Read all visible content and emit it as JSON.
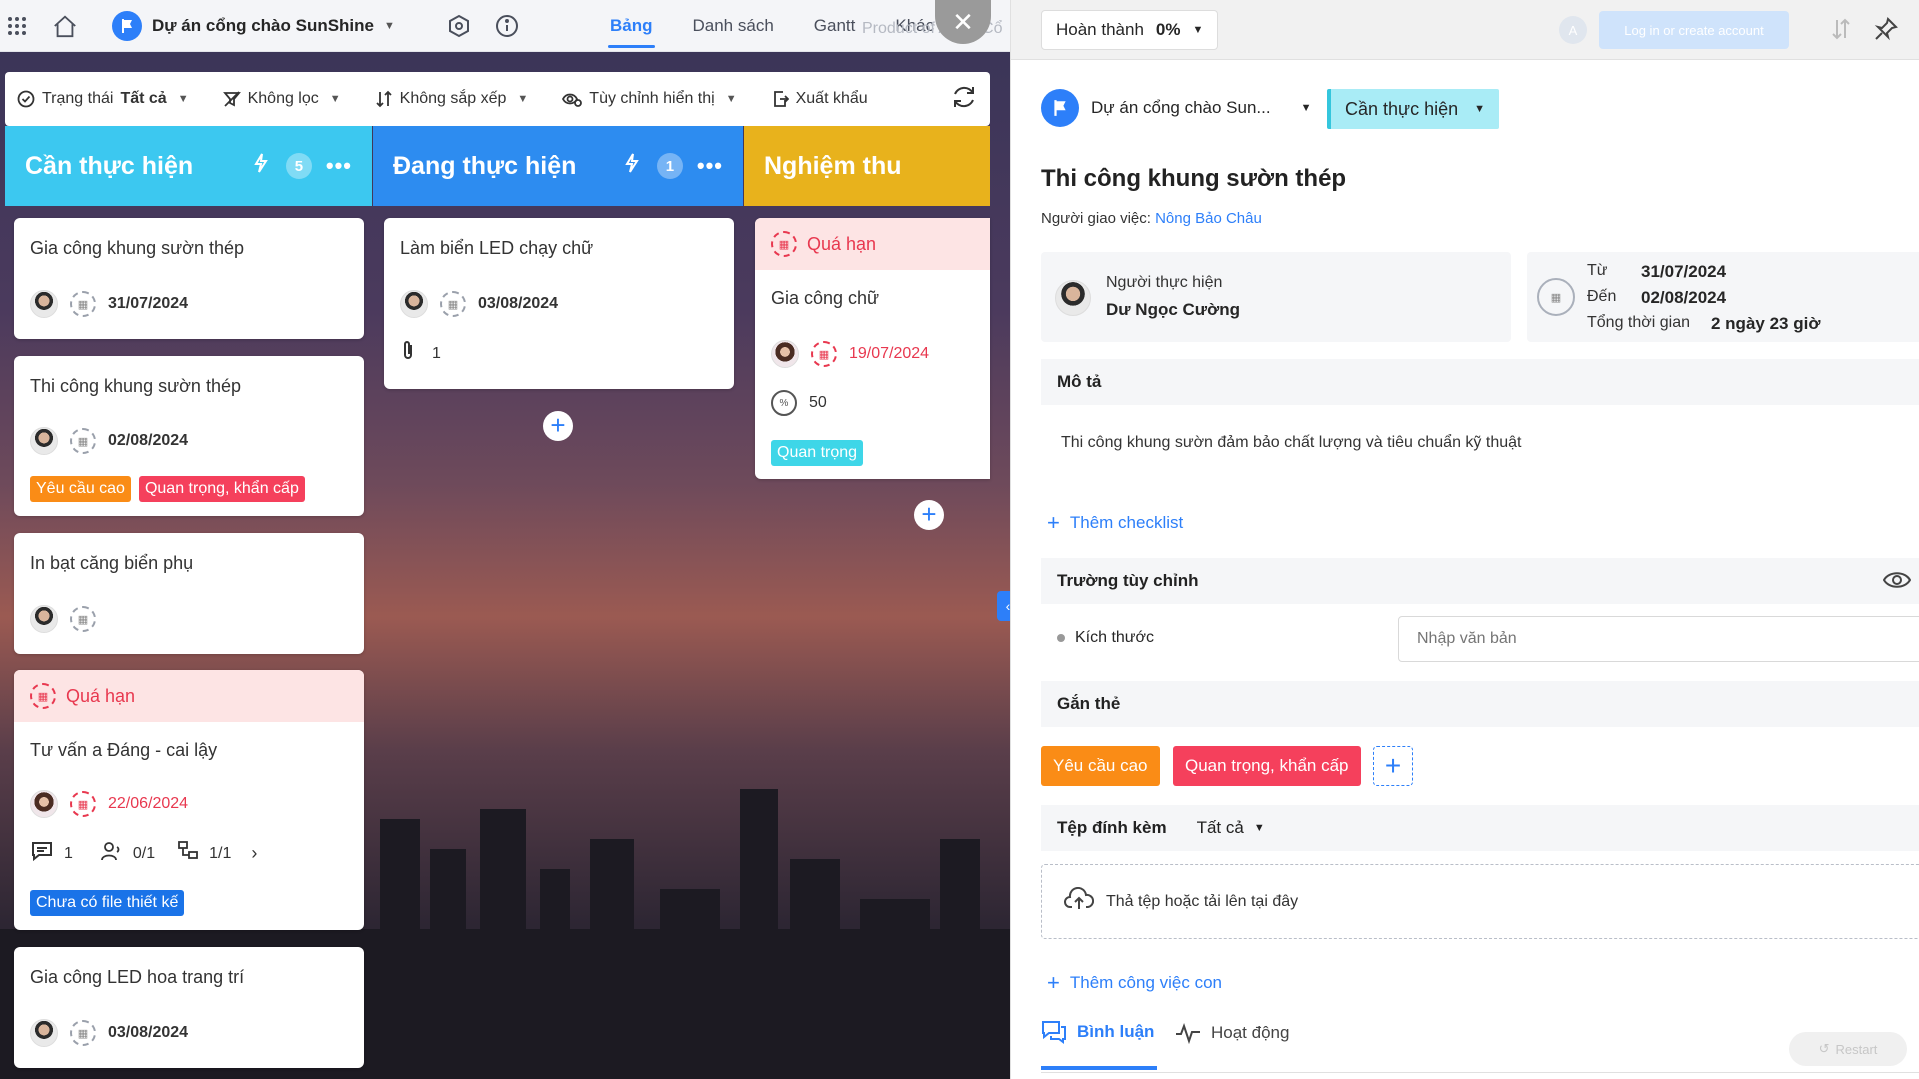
{
  "topbar": {
    "project_name": "Dự án cổng chào SunShine",
    "tabs": [
      {
        "label": "Bảng",
        "active": true
      },
      {
        "label": "Danh sách",
        "active": false
      },
      {
        "label": "Gantt",
        "active": false
      },
      {
        "label": "Khác",
        "active": false
      }
    ],
    "overlay_text": "Product of AMIS Cổ"
  },
  "filters": {
    "status_label": "Trạng thái",
    "status_value": "Tất cả",
    "filter_label": "Không lọc",
    "sort_label": "Không sắp xếp",
    "custom_view_label": "Tùy chỉnh hiển thị",
    "export_label": "Xuất khẩu"
  },
  "columns": [
    {
      "title": "Cần thực hiện",
      "count": "5",
      "color": "#3cc8f0"
    },
    {
      "title": "Đang thực hiện",
      "count": "1",
      "color": "#2d8cf0"
    },
    {
      "title": "Nghiệm thu",
      "color": "#e8b21c"
    }
  ],
  "cards": {
    "c1": {
      "title": "Gia công khung sườn thép",
      "date": "31/07/2024"
    },
    "c2": {
      "title": "Thi công khung sườn thép",
      "date": "02/08/2024",
      "tags": [
        "Yêu cầu cao",
        "Quan trọng, khẩn cấp"
      ]
    },
    "c3": {
      "title": "In bạt căng biển phụ"
    },
    "c4": {
      "overdue": "Quá hạn",
      "title": "Tư vấn a Đáng - cai lậy",
      "date": "22/06/2024",
      "comments": "1",
      "assignees": "0/1",
      "subtasks": "1/1",
      "tag": "Chưa có file thiết kế"
    },
    "c5": {
      "title": "Gia công LED hoa trang trí",
      "date": "03/08/2024"
    },
    "c6": {
      "title": "Làm biển LED chạy chữ",
      "date": "03/08/2024",
      "attachments": "1"
    },
    "c7": {
      "overdue": "Quá hạn",
      "title": "Gia công chữ",
      "date": "19/07/2024",
      "progress": "50",
      "tag": "Quan trọng"
    }
  },
  "panel": {
    "done_label": "Hoàn thành",
    "done_pct": "0%",
    "login_avatar": "A",
    "login_label": "Log in or create account",
    "project_short": "Dự án cổng chào Sun...",
    "status": "Cần thực hiện",
    "task_title": "Thi công khung sườn thép",
    "assigner_label": "Người giao việc:",
    "assigner_name": "Nông Bảo Châu",
    "assignee_label": "Người thực hiện",
    "assignee_name": "Dư Ngọc Cường",
    "from_label": "Từ",
    "from_date": "31/07/2024",
    "to_label": "Đến",
    "to_date": "02/08/2024",
    "total_label": "Tổng thời gian",
    "total_value": "2 ngày 23 giờ",
    "desc_header": "Mô tả",
    "desc_text": "Thi công khung sườn đảm bảo chất lượng và tiêu chuẩn kỹ thuật",
    "add_checklist": "Thêm checklist",
    "custom_fields_header": "Trường tùy chỉnh",
    "size_label": "Kích thước",
    "size_placeholder": "Nhập văn bản",
    "tags_header": "Gắn thẻ",
    "tags": [
      "Yêu cầu cao",
      "Quan trọng, khẩn cấp"
    ],
    "attach_header": "Tệp đính kèm",
    "attach_filter": "Tất cả",
    "upload_text": "Thả tệp hoặc tải lên tại đây",
    "add_subtask": "Thêm công việc con",
    "tab_comments": "Bình luận",
    "tab_activity": "Hoạt động",
    "restart_label": "Restart"
  },
  "colors": {
    "primary": "#2d7ff9",
    "danger": "#e8384f",
    "orange": "#fa8c16"
  }
}
